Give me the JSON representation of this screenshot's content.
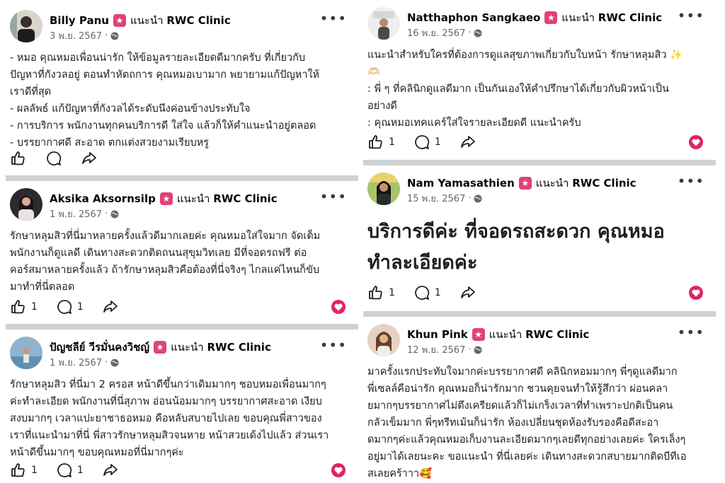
{
  "recommend_label": "แนะนำ",
  "clinic": "RWC Clinic",
  "more_icon": "more-horizontal-icon",
  "posts": [
    {
      "name": "Billy Panu",
      "date": "3 พ.ย. 2567",
      "lines": [
        "- หมอ   คุณหมอเพื่อนน่ารัก ให้ข้อมูลรายละเอียดดีมากครับ ที่เกี่ยวกับ",
        "ปัญหาที่กังวลอยู่ ตอนทำหัตถการ คุณหมอเบามาก พยายามแก้ปัญหาให้",
        "เราดีที่สุด",
        "- ผลลัพธ์ แก้ปัญหาที่กังวลได้ระดับนึงค่อนข้างประทับใจ",
        "- การบริการ พนักงานทุกคนบริการดี ใส่ใจ แล้วก็ให้คำแนะนำอยู่ตลอด",
        "- บรรยากาศดี สะอาด ตกแต่งสวยงามเรียบหรู"
      ],
      "like_count": "",
      "comment_count": "",
      "has_reaction": false
    },
    {
      "name": "Aksika Aksornsilp",
      "date": "1 พ.ย. 2567",
      "lines": [
        "รักษาหลุมสิวที่นี่มาหลายครั้งแล้วดีมากเลยค่ะ คุณหมอใส่ใจมาก จัดเต็ม",
        "พนักงานก็ดูแลดี เดินทางสะดวกติดถนนสุขุมวิทเลย มีที่จอดรถฟรี ต่อ",
        "คอร์สมาหลายครั้งแล้ว ถ้ารักษาหลุมสิวคือต้องที่นี่จริงๆ ไกลแค่ไหนก็ขับ",
        "มาทำที่นี่ตลอด"
      ],
      "like_count": "1",
      "comment_count": "1",
      "has_reaction": true
    },
    {
      "name": "ปัญชลีย์ วีรมั่นคงวิชญ์",
      "date": "1 พ.ย. 2567",
      "lines": [
        "รักษาหลุมสิว ที่นี่มา 2 ครอส หน้าดีขึ้นกว่าเดิมมากๆ ชอบหมอเพื่อนมากๆ",
        "ค่ะทำละเอียด พนักงานที่นี่สุภาพ อ่อนน้อมมากๆ บรรยากาศสะอาด เงียบ",
        "สงบมากๆ เวลาแปะยาชาธอหมอ คือหลับสบายไปเลย ขอบคุณพี่สาวของ",
        "เราที่แนะนำมาที่นี่ พี่สาวรักษาหลุมสิวจนหาย หน้าสวยเด้งไปแล้ว ส่วนเรา",
        "หน้าดีขึ้นมากๆ ขอบคุณหมอที่นี่มากๆค่ะ"
      ],
      "like_count": "1",
      "comment_count": "1",
      "has_reaction": true
    },
    {
      "name": "Natthaphon Sangkaeo",
      "date": "16 พ.ย. 2567",
      "lines": [
        "แนะนำสำหรับใครที่ต้องการดูแลสุขภาพเกี่ยวกับใบหน้า รักษาหลุมสิว ✨",
        "🫶🏻",
        ": พี่ ๆ ที่คลินิกดูแลดีมาก เป็นกันเองให้คำปรึกษาได้เกี่ยวกับผิวหน้าเป็น",
        "อย่างดี",
        ": คุณหมอเทคแคร์ใส่ใจรายละเอียดดี แนะนำครับ"
      ],
      "like_count": "1",
      "comment_count": "1",
      "has_reaction": true
    },
    {
      "name": "Nam Yamasathien",
      "date": "15 พ.ย. 2567",
      "lines": [
        "บริการดีค่ะ ที่จอดรถสะดวก คุณหมอ",
        "ทำละเอียดค่ะ"
      ],
      "like_count": "1",
      "comment_count": "1",
      "has_reaction": true
    },
    {
      "name": "Khun Pink",
      "date": "12 พ.ย. 2567",
      "lines": [
        "มาครั้งแรกประทับใจมากค่ะบรรยากาศดี คลินิกหอมมากๆ พี่ๆดูแลดีมาก",
        "พี่เซลล์คือน่ารัก คุณหมอก็น่ารักมาก ชวนคุยจนทำให้รู้สึกว่า ผ่อนคลา",
        "ยมากๆบรรยากาศไม่ตึงเครียดแล้วก็ไม่เกร็งเวลาที่ทำเพราะปกติเป็นคน",
        "กลัวเข็มมาก พี่ๆทรีทเม้นก็น่ารัก ห้องเปลี่ยนชุดห้องรับรองคือดีสะอา",
        "ดมากๆค่ะแล้วคุณหมอเก็บงานละเอียดมากๆเลยดีทุกอย่างเลยค่ะ ใครเล็งๆ",
        "อยู่มาได้เลยนะคะ ขอแนะนำ ที่นี่เลยค่ะ เดินทางสะดวกสบายมากติดบีทีเอ",
        "สเลยคร้าาา🥰"
      ],
      "like_count": "",
      "comment_count": "",
      "has_reaction": false
    }
  ]
}
